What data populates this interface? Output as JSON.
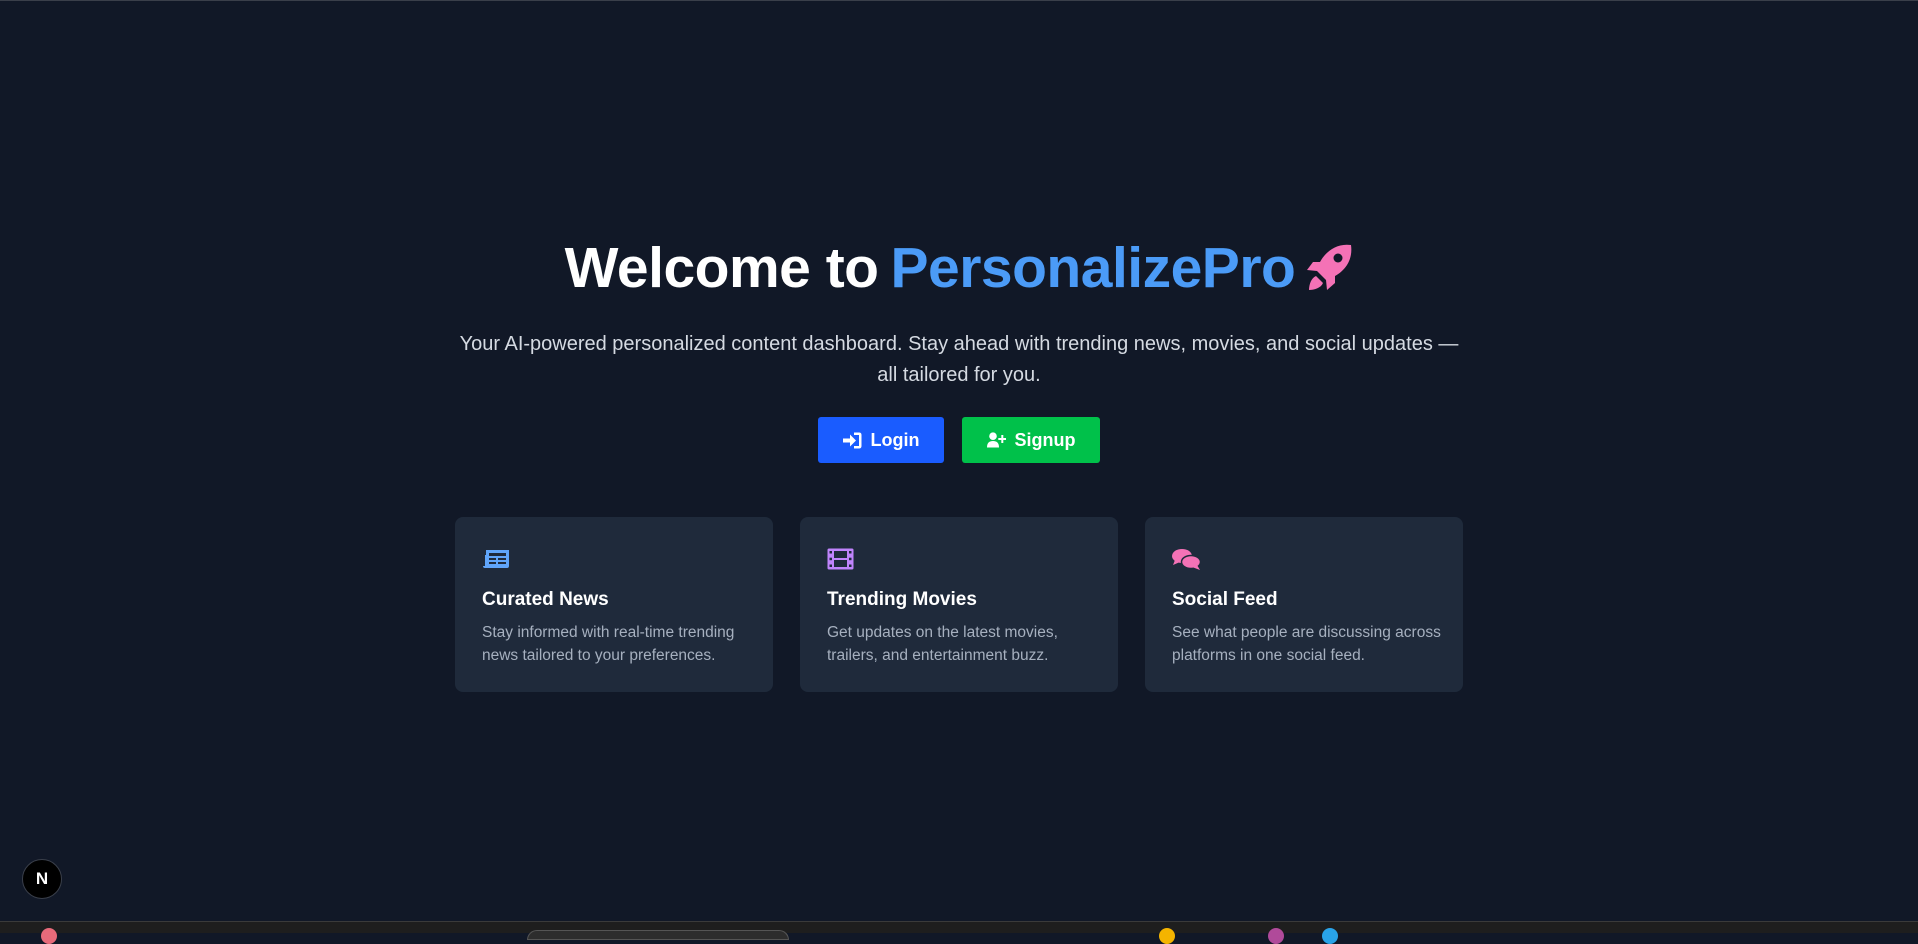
{
  "hero": {
    "title_prefix": "Welcome to",
    "title_brand": "PersonalizePro",
    "title_icon": "rocket-icon",
    "subtitle": "Your AI-powered personalized content dashboard. Stay ahead with trending news, movies, and social updates — all tailored for you."
  },
  "actions": {
    "login_label": "Login",
    "login_icon": "sign-in-icon",
    "signup_label": "Signup",
    "signup_icon": "user-plus-icon"
  },
  "features": [
    {
      "icon": "newspaper-icon",
      "title": "Curated News",
      "text": "Stay informed with real-time trending news tailored to your preferences."
    },
    {
      "icon": "film-icon",
      "title": "Trending Movies",
      "text": "Get updates on the latest movies, trailers, and entertainment buzz."
    },
    {
      "icon": "comments-icon",
      "title": "Social Feed",
      "text": "See what people are discussing across platforms in one social feed."
    }
  ],
  "dev_badge": {
    "label": "N"
  },
  "colors": {
    "background": "#111827",
    "brand": "#4b9bf7",
    "rocket": "#f472b6",
    "login": "#1a5cff",
    "signup": "#00c14a",
    "card": "#1f2a3b",
    "news_icon": "#60a5fa",
    "film_icon": "#c084fc",
    "comments_icon": "#f472b6"
  }
}
